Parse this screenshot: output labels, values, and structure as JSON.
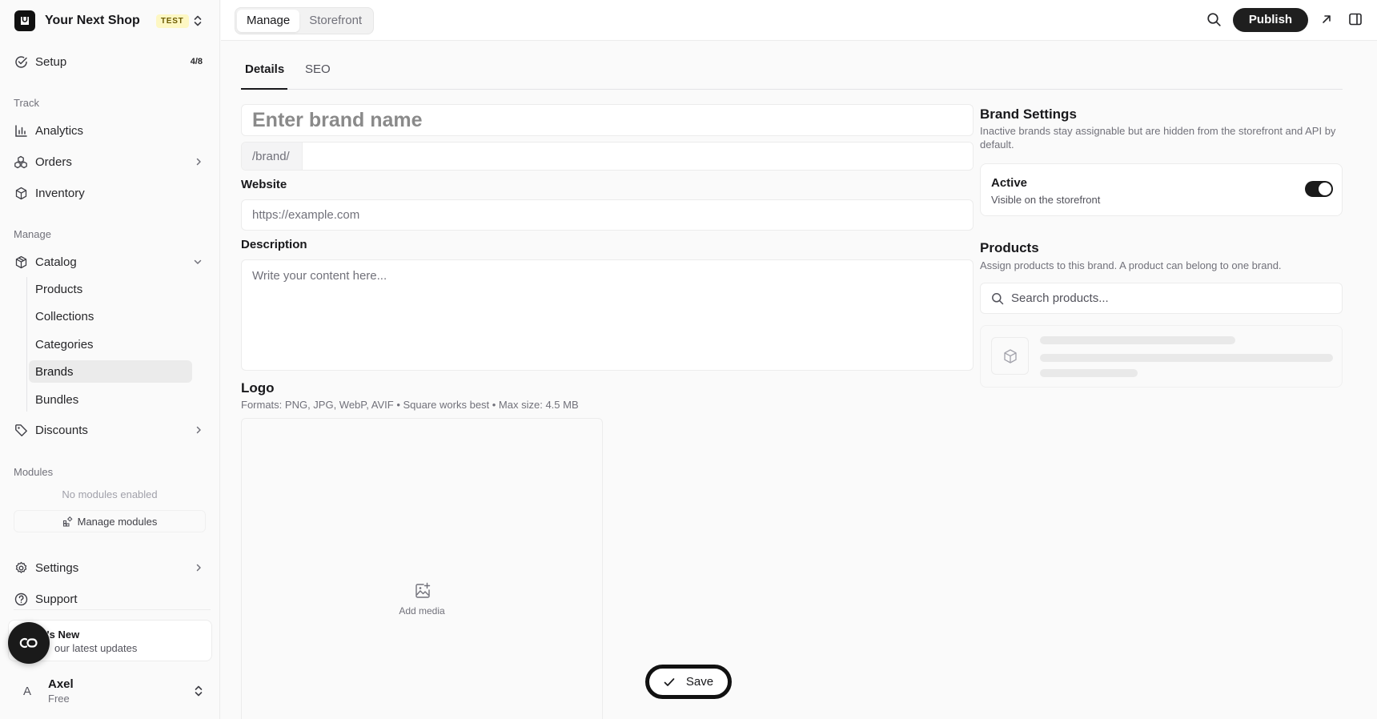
{
  "shop": {
    "name": "Your Next Shop",
    "badge": "TEST"
  },
  "sidebar": {
    "setup": {
      "label": "Setup",
      "count": "4/8"
    },
    "track_label": "Track",
    "track": [
      {
        "label": "Analytics",
        "icon": "bar-chart-icon"
      },
      {
        "label": "Orders",
        "icon": "orders-icon"
      },
      {
        "label": "Inventory",
        "icon": "box-icon"
      }
    ],
    "manage_label": "Manage",
    "catalog": {
      "label": "Catalog",
      "icon": "package-icon"
    },
    "catalog_items": [
      {
        "label": "Products"
      },
      {
        "label": "Collections"
      },
      {
        "label": "Categories"
      },
      {
        "label": "Brands",
        "active": true
      },
      {
        "label": "Bundles"
      }
    ],
    "discounts": {
      "label": "Discounts",
      "icon": "tag-icon"
    },
    "modules_label": "Modules",
    "no_modules": "No modules enabled",
    "manage_modules": "Manage modules",
    "settings": {
      "label": "Settings",
      "icon": "gear-icon"
    },
    "support": {
      "label": "Support",
      "icon": "help-circle-icon"
    },
    "whats_new": {
      "title": "at's New",
      "subtitle": "our latest updates"
    },
    "user": {
      "initial": "A",
      "name": "Axel",
      "plan": "Free"
    }
  },
  "topbar": {
    "modes": [
      {
        "label": "Manage",
        "active": true
      },
      {
        "label": "Storefront"
      }
    ],
    "publish": "Publish"
  },
  "tabs": [
    {
      "label": "Details",
      "active": true
    },
    {
      "label": "SEO"
    }
  ],
  "form": {
    "name_placeholder": "Enter brand name",
    "slug_prefix": "/brand/",
    "website_label": "Website",
    "website_placeholder": "https://example.com",
    "description_label": "Description",
    "description_placeholder": "Write your content here...",
    "logo_title": "Logo",
    "logo_formats": "Formats: PNG, JPG, WebP, AVIF  •  Square works best  •  Max size: 4.5 MB",
    "add_media": "Add media"
  },
  "brand_settings": {
    "title": "Brand Settings",
    "description": "Inactive brands stay assignable but are hidden from the storefront and API by default.",
    "active_title": "Active",
    "active_subtitle": "Visible on the storefront",
    "active_on": true
  },
  "products": {
    "title": "Products",
    "description": "Assign products to this brand. A product can belong to one brand.",
    "search_placeholder": "Search products..."
  },
  "save": "Save",
  "colors": {
    "accent": "#1f1f1f",
    "badge_bg": "#fdf7c3",
    "active_bg": "#ebebeb"
  }
}
